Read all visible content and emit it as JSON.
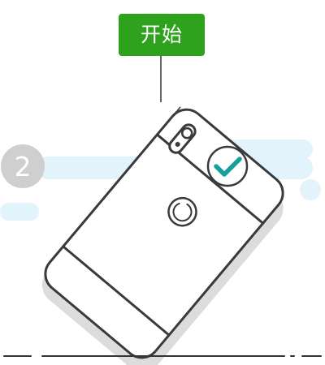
{
  "start_button": {
    "label": "开始"
  },
  "step": {
    "number": "2"
  },
  "status_icon": "checkmark-circle-icon",
  "colors": {
    "accent_green": "#2ea21c",
    "check_teal": "#16a09a",
    "cloud_blue": "#e2f3fb",
    "step_badge_gray": "#cfcfcf",
    "outline_dark": "#3a3a3a",
    "shadow_gray": "#dcdcdc"
  }
}
